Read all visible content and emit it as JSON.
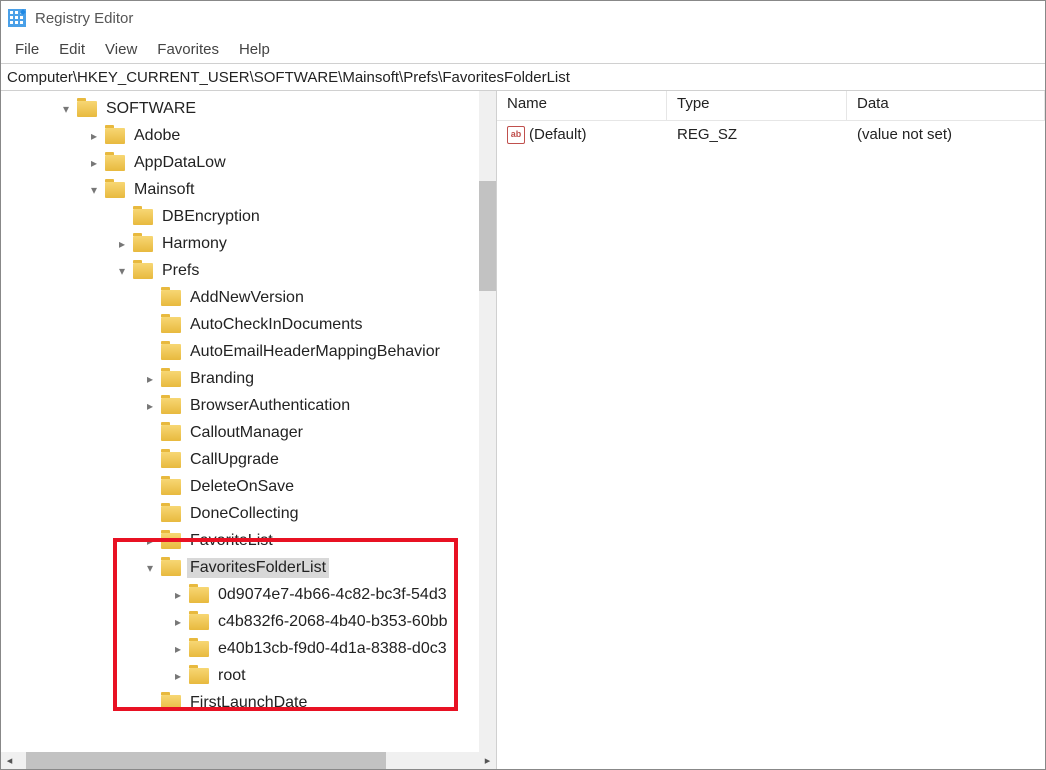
{
  "title": "Registry Editor",
  "menu": {
    "file": "File",
    "edit": "Edit",
    "view": "View",
    "favorites": "Favorites",
    "help": "Help"
  },
  "address": "Computer\\HKEY_CURRENT_USER\\SOFTWARE\\Mainsoft\\Prefs\\FavoritesFolderList",
  "tree": {
    "software": "SOFTWARE",
    "adobe": "Adobe",
    "appdatalow": "AppDataLow",
    "mainsoft": "Mainsoft",
    "dbencryption": "DBEncryption",
    "harmony": "Harmony",
    "prefs": "Prefs",
    "addnewversion": "AddNewVersion",
    "autocheckindocuments": "AutoCheckInDocuments",
    "autoemailheader": "AutoEmailHeaderMappingBehavior",
    "branding": "Branding",
    "browserauth": "BrowserAuthentication",
    "calloutmanager": "CalloutManager",
    "callupgrade": "CallUpgrade",
    "deleteonsave": "DeleteOnSave",
    "donecollecting": "DoneCollecting",
    "favoritelist": "FavoriteList",
    "favoritesfolderlist": "FavoritesFolderList",
    "guid1": "0d9074e7-4b66-4c82-bc3f-54d3",
    "guid2": "c4b832f6-2068-4b40-b353-60bb",
    "guid3": "e40b13cb-f9d0-4d1a-8388-d0c3",
    "root": "root",
    "firstlaunchdate": "FirstLaunchDate"
  },
  "list": {
    "headers": {
      "name": "Name",
      "type": "Type",
      "data": "Data"
    },
    "rows": [
      {
        "name": "(Default)",
        "type": "REG_SZ",
        "data": "(value not set)"
      }
    ]
  }
}
